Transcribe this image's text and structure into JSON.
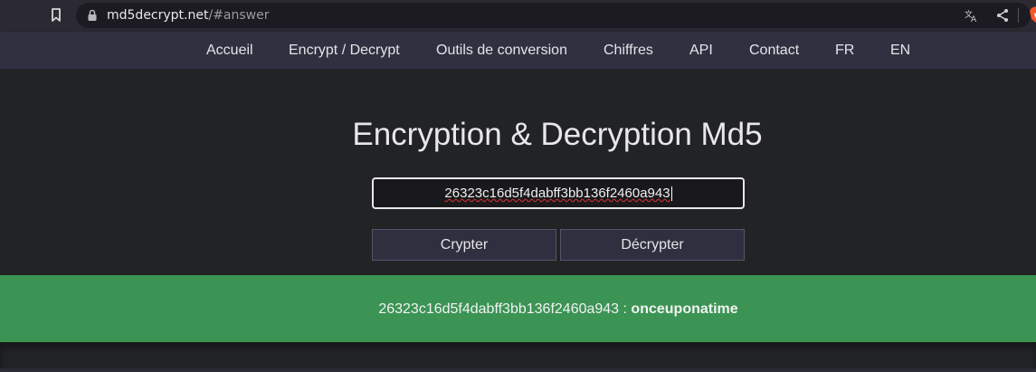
{
  "browser": {
    "url_host": "md5decrypt.net",
    "url_rest": "/#answer",
    "icons": [
      "bookmark-icon",
      "lock-icon",
      "translate-icon",
      "share-icon",
      "brave-icon"
    ]
  },
  "nav": {
    "items": [
      {
        "label": "Accueil"
      },
      {
        "label": "Encrypt / Decrypt"
      },
      {
        "label": "Outils de conversion"
      },
      {
        "label": "Chiffres"
      },
      {
        "label": "API"
      },
      {
        "label": "Contact"
      },
      {
        "label": "FR"
      },
      {
        "label": "EN"
      }
    ]
  },
  "main": {
    "title": "Encryption & Decryption Md5",
    "input_value": "26323c16d5f4dabff3bb136f2460a943",
    "encrypt_label": "Crypter",
    "decrypt_label": "Décrypter"
  },
  "result": {
    "hash": "26323c16d5f4dabff3bb136f2460a943",
    "separator": " : ",
    "answer": "onceuponatime"
  },
  "colors": {
    "background": "#222325",
    "nav_background": "#303041",
    "result_background": "#3b9454",
    "button_background": "#2f2f40"
  }
}
